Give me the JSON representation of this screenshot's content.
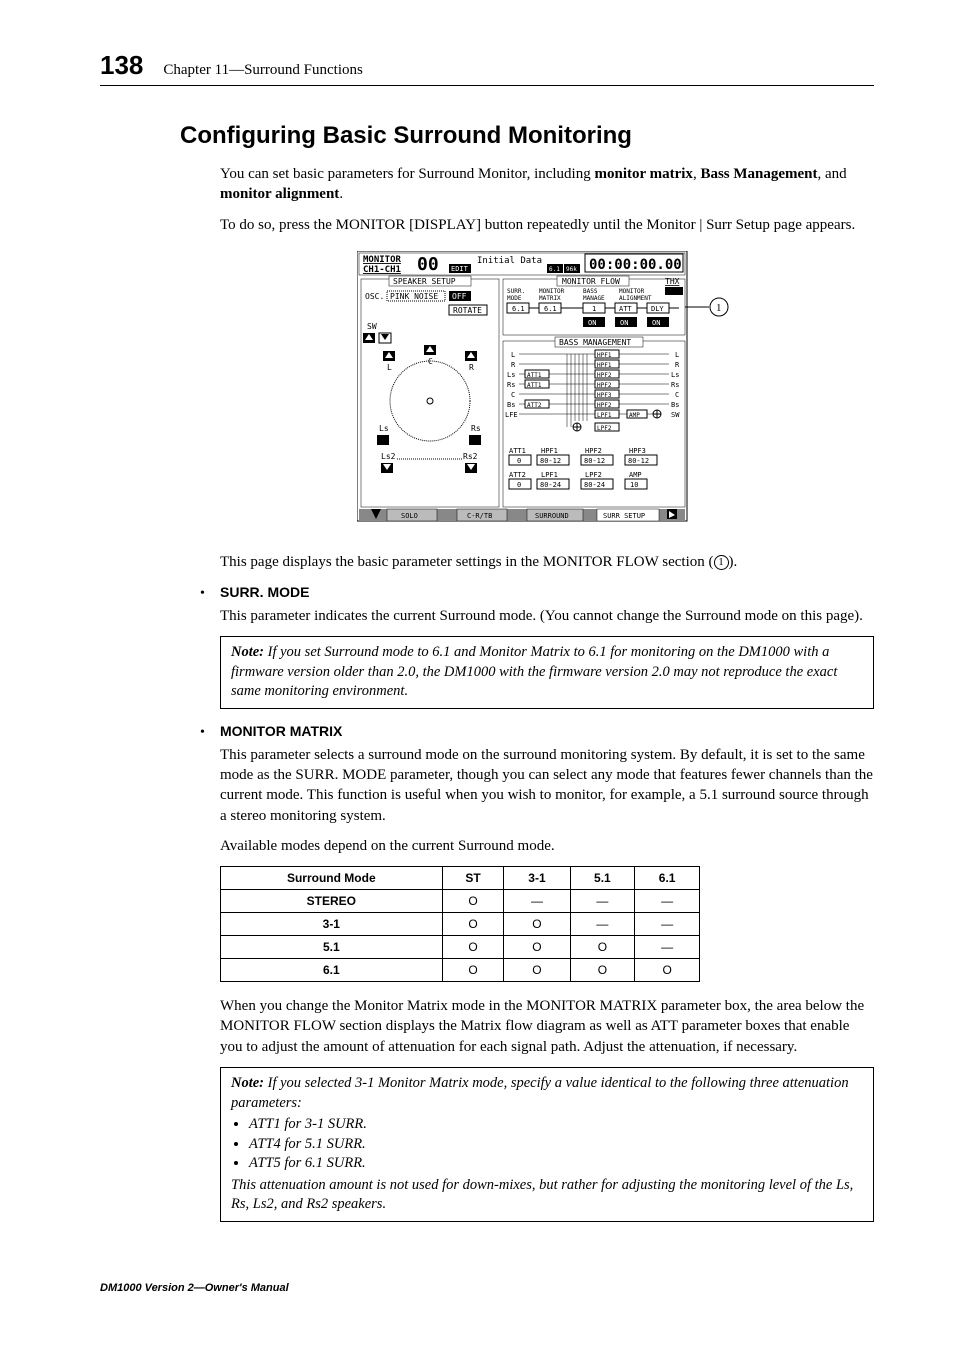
{
  "header": {
    "page_number": "138",
    "chapter": "Chapter 11—Surround Functions"
  },
  "h1": "Configuring Basic Surround Monitoring",
  "intro": {
    "p1_a": "You can set basic parameters for Surround Monitor, including ",
    "p1_b1": "monitor matrix",
    "p1_sep1": ", ",
    "p1_b2": "Bass Management",
    "p1_sep2": ", and ",
    "p1_b3": "monitor alignment",
    "p1_end": ".",
    "p2": "To do so, press the MONITOR [DISPLAY] button repeatedly until the Monitor | Surr Setup page appears."
  },
  "figure": {
    "callout": "1",
    "top": {
      "monitor": "MONITOR",
      "ch": "CH1-CH1",
      "oo": "00",
      "edit": "EDIT",
      "initial": "Initial Data",
      "clock": "00:00:00.00",
      "sixone": "6.1",
      "ninetysix": "96k"
    },
    "left_panel": {
      "title": "SPEAKER SETUP",
      "osc": "OSC.",
      "pink": "PINK NOISE",
      "off": "OFF",
      "rotate": "ROTATE",
      "sw": "SW",
      "L": "L",
      "C": "C",
      "R": "R",
      "Ls": "Ls",
      "Rs": "Rs",
      "Ls2": "Ls2",
      "Rs2": "Rs2"
    },
    "right_panel": {
      "title": "MONITOR FLOW",
      "thx": "THX",
      "surr_mode": "SURR.\nMODE",
      "mon_matrix": "MONITOR\nMATRIX",
      "bass_manage": "BASS\nMANAGE",
      "mon_align": "MONITOR\nALIGNMENT",
      "sixone_a": "6.1",
      "sixone_b": "6.1",
      "one": "1",
      "att": "ATT",
      "dly": "DLY",
      "on1": "ON",
      "on2": "ON",
      "on3": "ON",
      "bass_title": "BASS MANAGEMENT",
      "ch_left": [
        "L",
        "R",
        "Ls",
        "Rs",
        "C",
        "Bs",
        "LFE"
      ],
      "ch_right": [
        "L",
        "R",
        "Ls",
        "Rs",
        "C",
        "Bs",
        "SW"
      ],
      "att1": "ATT1",
      "att1b": "ATT1",
      "att2": "ATT2",
      "hpf1": "HPF1",
      "hpf1b": "HPF1",
      "hpf2": "HPF2",
      "hpf2b": "HPF2",
      "hpf3": "HPF3",
      "hpf2c": "HPF2",
      "lpf1": "LPF1",
      "lpf2": "LPF2",
      "amp": "AMP",
      "row1": {
        "att1": "ATT1",
        "v0": "0",
        "hpf1": "HPF1",
        "r1": "80-12",
        "hpf2": "HPF2",
        "r2": "80-12",
        "hpf3": "HPF3",
        "r3": "80-12"
      },
      "row2": {
        "att2": "ATT2",
        "v0": "0",
        "lpf1": "LPF1",
        "r1": "80-24",
        "lpf2": "LPF2",
        "r2": "80-24",
        "amp": "AMP",
        "r3": "10"
      }
    },
    "tabs": {
      "solo": "SOLO",
      "crtb": "C-R/TB",
      "surround": "SURROUND",
      "setup": "SURR SETUP"
    }
  },
  "after_fig": {
    "p1_a": "This page displays the basic parameter settings in the MONITOR FLOW section (",
    "p1_c": "1",
    "p1_b": ")."
  },
  "surr_mode": {
    "title": "SURR. MODE",
    "p1": "This parameter indicates the current Surround mode. (You cannot change the Surround mode on this page).",
    "note": "If you set Surround mode to 6.1 and Monitor Matrix to 6.1 for monitoring on the DM1000 with a firmware version older than 2.0, the DM1000 with the firmware version 2.0 may not reproduce the exact same monitoring environment."
  },
  "mon_matrix": {
    "title": "MONITOR MATRIX",
    "p1": "This parameter selects a surround mode on the surround monitoring system. By default, it is set to the same mode as the SURR. MODE parameter, though you can select any mode that features fewer channels than the current mode. This function is useful when you wish to monitor, for example, a 5.1 surround source through a stereo monitoring system.",
    "p2": "Available modes depend on the current Surround mode.",
    "table": {
      "header": [
        "Surround Mode",
        "ST",
        "3-1",
        "5.1",
        "6.1"
      ],
      "rows": [
        [
          "STEREO",
          "O",
          "—",
          "—",
          "—"
        ],
        [
          "3-1",
          "O",
          "O",
          "—",
          "—"
        ],
        [
          "5.1",
          "O",
          "O",
          "O",
          "—"
        ],
        [
          "6.1",
          "O",
          "O",
          "O",
          "O"
        ]
      ]
    },
    "p3": "When you change the Monitor Matrix mode in the MONITOR MATRIX parameter box, the area below the MONITOR FLOW section displays the Matrix flow diagram as well as ATT parameter boxes that enable you to adjust the amount of attenuation for each signal path. Adjust the attenuation, if necessary.",
    "note2_lead": "If you selected 3-1 Monitor Matrix mode, specify a value identical to the following three attenuation parameters:",
    "note2_items": [
      "ATT1 for 3-1 SURR.",
      "ATT4 for 5.1 SURR.",
      "ATT5 for 6.1 SURR."
    ],
    "note2_trail": "This attenuation amount is not used for down-mixes, but rather for adjusting the monitoring level of the Ls, Rs, Ls2, and Rs2 speakers."
  },
  "footer": "DM1000 Version 2—Owner's Manual",
  "note_label": "Note:  "
}
